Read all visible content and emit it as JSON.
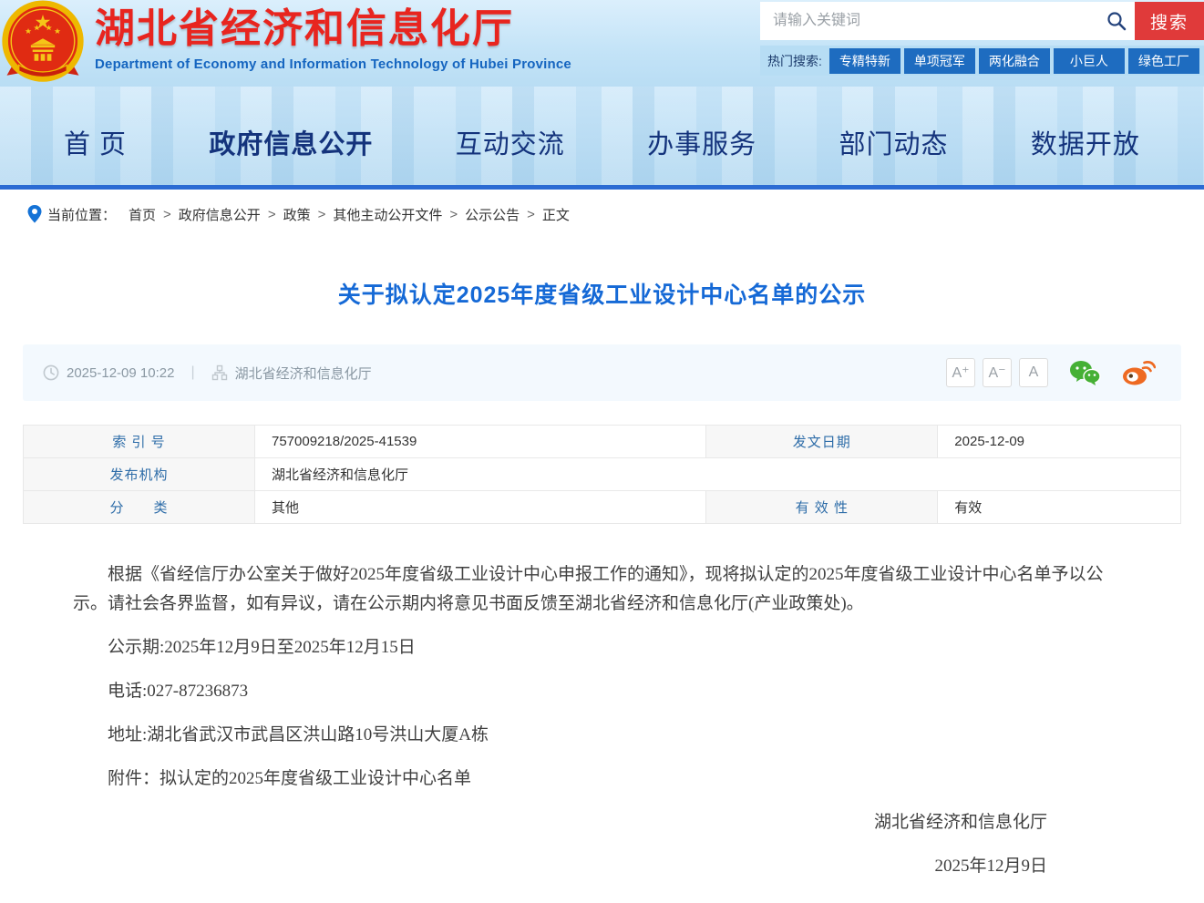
{
  "header": {
    "site_name": "湖北省经济和信息化厅",
    "site_name_en": "Department of Economy and Information Technology of Hubei Province",
    "search": {
      "placeholder": "请输入关键词",
      "button_label": "搜索"
    },
    "hot_search": {
      "label": "热门搜索:",
      "tags": [
        "专精特新",
        "单项冠军",
        "两化融合",
        "小巨人",
        "绿色工厂"
      ]
    }
  },
  "nav": {
    "items": [
      {
        "label": "首 页"
      },
      {
        "label": "政府信息公开"
      },
      {
        "label": "互动交流"
      },
      {
        "label": "办事服务"
      },
      {
        "label": "部门动态"
      },
      {
        "label": "数据开放"
      }
    ],
    "active_index": 1
  },
  "breadcrumb": {
    "prefix": "当前位置：",
    "separator": ">",
    "items": [
      "首页",
      "政府信息公开",
      "政策",
      "其他主动公开文件",
      "公示公告",
      "正文"
    ]
  },
  "article": {
    "title": "关于拟认定2025年度省级工业设计中心名单的公示",
    "meta": {
      "datetime": "2025-12-09 10:22",
      "divider": "|",
      "source": "湖北省经济和信息化厅",
      "font_size_buttons": [
        "A⁺",
        "A⁻",
        "A"
      ]
    },
    "info_table": {
      "rows": [
        {
          "cells": [
            {
              "label": "索 引 号",
              "value": "757009218/2025-41539"
            },
            {
              "label": "发文日期",
              "value": "2025-12-09"
            }
          ]
        },
        {
          "cells": [
            {
              "label": "发布机构",
              "value": "湖北省经济和信息化厅"
            }
          ]
        },
        {
          "cells": [
            {
              "label": "分　　类",
              "value": "其他"
            },
            {
              "label": "有 效 性",
              "value": "有效"
            }
          ]
        }
      ]
    },
    "paragraphs": [
      {
        "text": "根据《省经信厅办公室关于做好2025年度省级工业设计中心申报工作的通知》，现将拟认定的2025年度省级工业设计中心名单予以公示。请社会各界监督，如有异议，请在公示期内将意见书面反馈至湖北省经济和信息化厅(产业政策处)。"
      },
      {
        "text": "公示期:2025年12月9日至2025年12月15日"
      },
      {
        "text": "电话:027-87236873"
      },
      {
        "text": "地址:湖北省武汉市武昌区洪山路10号洪山大厦A栋"
      }
    ],
    "attachment": {
      "label": "附件：",
      "name": "拟认定的2025年度省级工业设计中心名单"
    },
    "signature": {
      "org": "湖北省经济和信息化厅",
      "date": "2025年12月9日"
    }
  },
  "colors": {
    "brand_red": "#e8251f",
    "title_blue": "#1569d6",
    "nav_navy": "#14337c",
    "accent_blue": "#1e6cc0",
    "search_button_red": "#e03a3a",
    "hot_row_bg": "#b7ddf4",
    "table_label_blue": "#2d6ca8",
    "wechat_green": "#45b035",
    "weibo_orange": "#ee6a22"
  }
}
